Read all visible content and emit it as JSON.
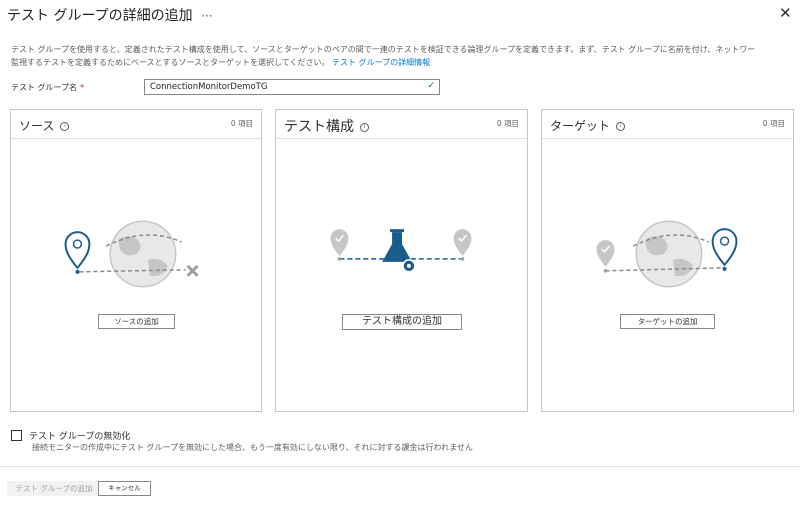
{
  "header": {
    "title": "テスト グループの詳細の追加",
    "more": "···",
    "close": "✕"
  },
  "description": {
    "line1": "テスト グループを使用すると、定義されたテスト構成を使用して、ソースとターゲットのペアの間で一連のテストを検証できる論理グループを定義できます。まず、テスト グループに名前を付け、ネットワー",
    "line2_prefix": "監視するテストを定義するためにベースとするソースとターゲットを選択してください。",
    "line2_link": "テスト グループの詳細情報"
  },
  "form": {
    "name_label": "テスト グループ名",
    "required_mark": "*",
    "name_value": "ConnectionMonitorDemoTG"
  },
  "cards": {
    "source": {
      "title": "ソース",
      "info": "i",
      "count": "0 項目",
      "add_label": "ソースの追加"
    },
    "config": {
      "title": "テスト構成",
      "info": "i",
      "count": "0 項目",
      "add_label": "テスト構成の追加"
    },
    "target": {
      "title": "ターゲット",
      "info": "i",
      "count": "0 項目",
      "add_label": "ターゲットの追加"
    }
  },
  "disable": {
    "label": "テスト グループの無効化",
    "description": "接続モニターの作成中にテスト グループを無効にした場合、もう一度有効にしない限り、それに対する課金は行われません"
  },
  "footer": {
    "add_label": "テスト グループの追加",
    "cancel_label": "キャンセル"
  },
  "colors": {
    "accent": "#0078d4",
    "pin_blue": "#1c5c8c",
    "pin_gray": "#c8c6c4",
    "globe": "#c8c6c4",
    "valid_check": "#107c10"
  }
}
